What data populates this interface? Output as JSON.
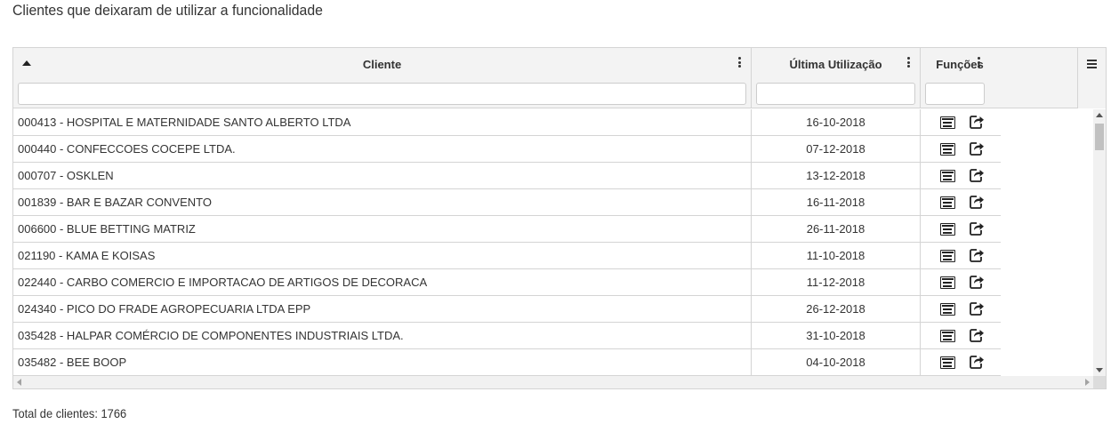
{
  "page": {
    "title": "Clientes que deixaram de utilizar a funcionalidade"
  },
  "grid": {
    "columns": [
      {
        "label": "Cliente",
        "sorted": "ascending"
      },
      {
        "label": "Última Utilização"
      },
      {
        "label": "Funções"
      }
    ],
    "filters": {
      "cliente_value": "",
      "ultima_value": "",
      "funcoes_value": ""
    },
    "rows": [
      {
        "cliente": "000413 - HOSPITAL E MATERNIDADE SANTO ALBERTO LTDA",
        "data": "16-10-2018"
      },
      {
        "cliente": "000440 - CONFECCOES COCEPE LTDA.",
        "data": "07-12-2018"
      },
      {
        "cliente": "000707 - OSKLEN",
        "data": "13-12-2018"
      },
      {
        "cliente": "001839 - BAR E BAZAR CONVENTO",
        "data": "16-11-2018"
      },
      {
        "cliente": "006600 - BLUE BETTING MATRIZ",
        "data": "26-11-2018"
      },
      {
        "cliente": "021190 - KAMA E KOISAS",
        "data": "11-10-2018"
      },
      {
        "cliente": "022440 - CARBO COMERCIO E IMPORTACAO DE ARTIGOS DE DECORACA",
        "data": "11-12-2018"
      },
      {
        "cliente": "024340 - PICO DO FRADE AGROPECUARIA LTDA EPP",
        "data": "26-12-2018"
      },
      {
        "cliente": "035428 - HALPAR COMÉRCIO DE COMPONENTES INDUSTRIAIS LTDA.",
        "data": "31-10-2018"
      },
      {
        "cliente": "035482 - BEE BOOP",
        "data": "04-10-2018"
      }
    ],
    "row_icons": [
      "list-details-icon",
      "share-icon"
    ]
  },
  "footer": {
    "total": "Total de clientes: 1766"
  }
}
